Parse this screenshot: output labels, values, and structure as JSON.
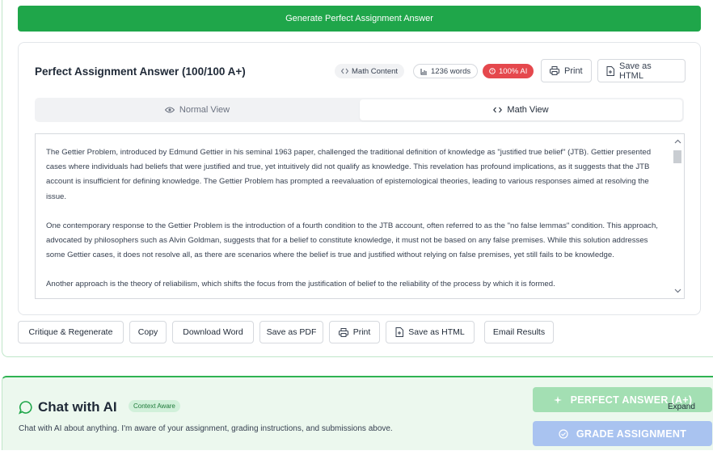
{
  "toolbar": {
    "generate_label": "Generate Perfect Assignment Answer"
  },
  "answer": {
    "title": "Perfect Assignment Answer (100/100 A+)",
    "badges": {
      "math_content": "Math Content",
      "word_count": "1236 words",
      "ai_score": "100% AI"
    },
    "header_buttons": {
      "print": "Print",
      "save_html": "Save as HTML"
    },
    "view_toggle": {
      "normal": "Normal View",
      "math": "Math View",
      "active": "math"
    },
    "paragraphs": [
      "The Gettier Problem, introduced by Edmund Gettier in his seminal 1963 paper, challenged the traditional definition of knowledge as \"justified true belief\" (JTB). Gettier presented cases where individuals had beliefs that were justified and true, yet intuitively did not qualify as knowledge. This revelation has profound implications, as it suggests that the JTB account is insufficient for defining knowledge. The Gettier Problem has prompted a reevaluation of epistemological theories, leading to various responses aimed at resolving the issue.",
      "One contemporary response to the Gettier Problem is the introduction of a fourth condition to the JTB account, often referred to as the \"no false lemmas\" condition. This approach, advocated by philosophers such as Alvin Goldman, suggests that for a belief to constitute knowledge, it must not be based on any false premises. While this solution addresses some Gettier cases, it does not resolve all, as there are scenarios where the belief is true and justified without relying on false premises, yet still fails to be knowledge.",
      "Another approach is the theory of reliabilism, which shifts the focus from the justification of belief to the reliability of the process by which it is formed."
    ]
  },
  "actions": {
    "critique": "Critique & Regenerate",
    "copy": "Copy",
    "download_word": "Download Word",
    "save_pdf": "Save as PDF",
    "print": "Print",
    "save_html": "Save as HTML",
    "email": "Email Results"
  },
  "chat": {
    "title": "Chat with AI",
    "badge": "Context Aware",
    "description": "Chat with AI about anything. I'm aware of your assignment, grading instructions, and submissions above.",
    "perfect_button": "PERFECT ANSWER (A+)",
    "expand_tip": "Expand",
    "grade_button": "GRADE ASSIGNMENT"
  },
  "colors": {
    "primary_green": "#1fa64a",
    "ai_badge_red": "#e5484d",
    "perfect_btn": "#a3dfb3",
    "grade_btn": "#a9c3f0",
    "chat_bg": "#ecf8ee"
  },
  "icons": {
    "math_content": "code-icon",
    "word_count": "chart-icon",
    "ai_score": "warning-icon",
    "print": "printer-icon",
    "save_html": "file-export-icon",
    "normal_view": "eye-icon",
    "math_view": "code-icon",
    "chat": "chat-bubble-icon",
    "perfect": "sparkle-icon",
    "grade": "check-circle-icon"
  }
}
